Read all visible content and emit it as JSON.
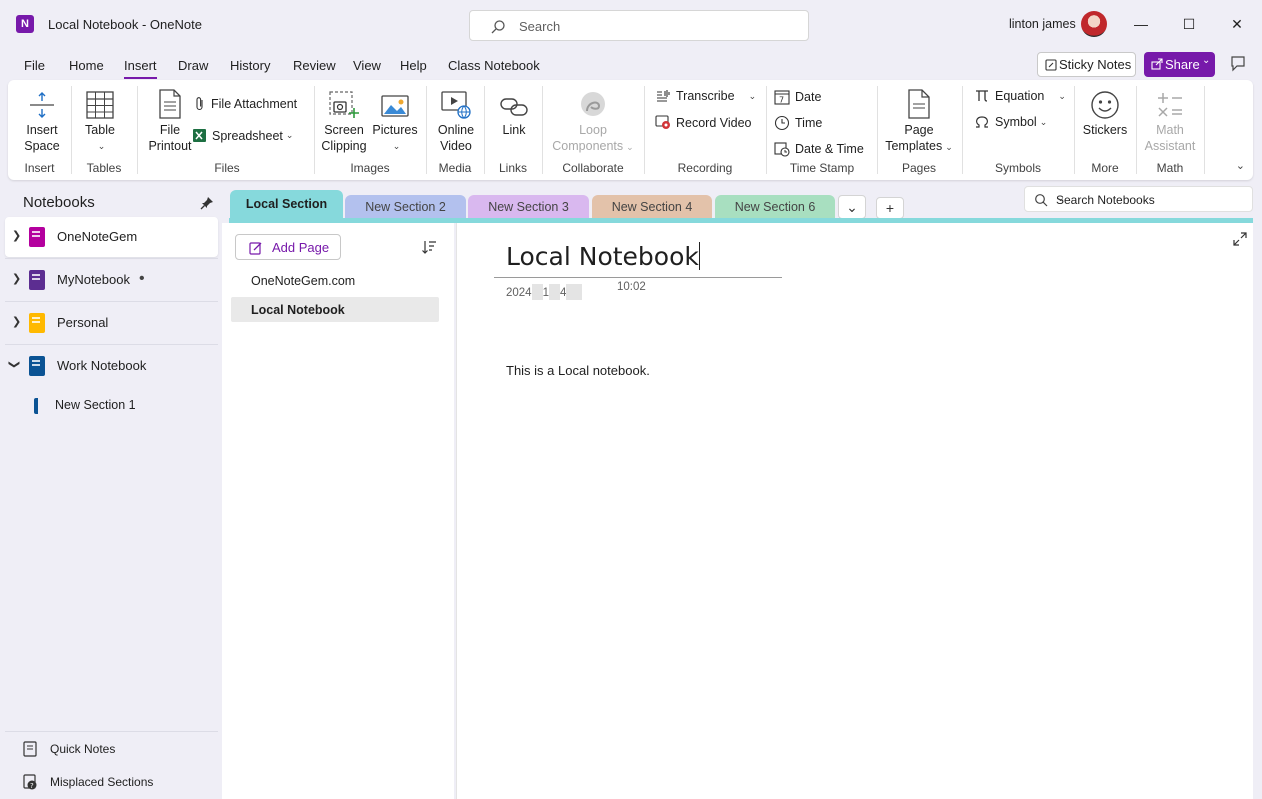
{
  "window": {
    "title": "Local Notebook  -  OneNote",
    "app_icon_letter": "N",
    "search_placeholder": "Search",
    "user_name": "linton james",
    "min_icon": "—",
    "max_icon": "☐",
    "close_icon": "✕"
  },
  "menu": {
    "items": [
      "File",
      "Home",
      "Insert",
      "Draw",
      "History",
      "Review",
      "View",
      "Help",
      "Class Notebook"
    ],
    "active": "Insert",
    "sticky_notes": "Sticky Notes",
    "share": "Share"
  },
  "ribbon": {
    "insert_space": [
      "Insert",
      "Space"
    ],
    "table": "Table",
    "file_printout": [
      "File",
      "Printout"
    ],
    "file_attachment": "File Attachment",
    "spreadsheet": "Spreadsheet",
    "screen_clipping": [
      "Screen",
      "Clipping"
    ],
    "pictures": "Pictures",
    "online_video": [
      "Online",
      "Video"
    ],
    "link": "Link",
    "loop_components": [
      "Loop",
      "Components"
    ],
    "transcribe": "Transcribe",
    "record_video": "Record Video",
    "date": "Date",
    "time": "Time",
    "date_time": "Date & Time",
    "page_templates": [
      "Page",
      "Templates"
    ],
    "equation": "Equation",
    "symbol": "Symbol",
    "stickers": "Stickers",
    "math_assistant": [
      "Math",
      "Assistant"
    ],
    "groups": {
      "insert": "Insert",
      "tables": "Tables",
      "files": "Files",
      "images": "Images",
      "media": "Media",
      "links": "Links",
      "collaborate": "Collaborate",
      "recording": "Recording",
      "time_stamp": "Time Stamp",
      "pages": "Pages",
      "symbols": "Symbols",
      "more": "More",
      "math": "Math"
    }
  },
  "nav": {
    "title": "Notebooks",
    "notebooks": [
      {
        "label": "OneNoteGem",
        "color": "#b4009e",
        "expanded": false,
        "selected": true
      },
      {
        "label": "MyNotebook",
        "color": "#5c2d91",
        "expanded": false,
        "selected": false,
        "unsynced_dot": "•"
      },
      {
        "label": "Personal",
        "color": "#ffb900",
        "expanded": false,
        "selected": false
      },
      {
        "label": "Work Notebook",
        "color": "#0b5394",
        "expanded": true,
        "selected": false
      }
    ],
    "section": "New Section 1",
    "quick_notes": "Quick Notes",
    "misplaced_sections": "Misplaced Sections"
  },
  "section_tabs": [
    {
      "label": "Local Section",
      "color": "#86d9dc",
      "active": true
    },
    {
      "label": "New Section 2",
      "color": "#b3c1ee",
      "active": false
    },
    {
      "label": "New Section 3",
      "color": "#d9b8ef",
      "active": false
    },
    {
      "label": "New Section 4",
      "color": "#e3c2aa",
      "active": false
    },
    {
      "label": "New Section 6",
      "color": "#a8dfc0",
      "active": false
    }
  ],
  "search_notebooks": "Search Notebooks",
  "pages": {
    "add_page": "Add Page",
    "items": [
      {
        "label": "OneNoteGem.com",
        "selected": false
      },
      {
        "label": "Local Notebook",
        "selected": true
      }
    ]
  },
  "page": {
    "title": "Local Notebook",
    "date_parts": [
      "2024",
      "1",
      "4"
    ],
    "time": "10:02",
    "body": "This is a Local notebook."
  }
}
